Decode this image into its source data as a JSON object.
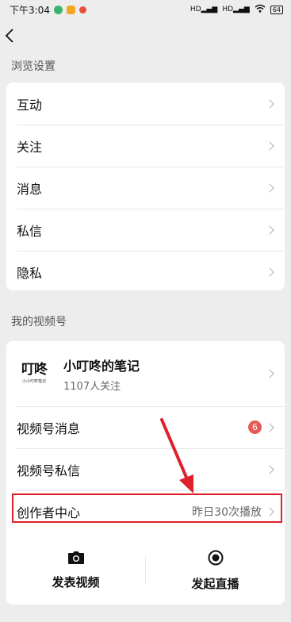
{
  "status_bar": {
    "time": "下午3:04",
    "signal1": "HD",
    "signal2": "HD",
    "battery": "64"
  },
  "browse_settings": {
    "title": "浏览设置",
    "items": [
      {
        "label": "互动"
      },
      {
        "label": "关注"
      },
      {
        "label": "消息"
      },
      {
        "label": "私信"
      },
      {
        "label": "隐私"
      }
    ]
  },
  "channels": {
    "title": "我的视频号",
    "profile": {
      "avatar_text": "叮咚",
      "avatar_caption": "小小叮咚笔记",
      "name": "小叮咚的笔记",
      "followers": "1107人关注"
    },
    "messages_label": "视频号消息",
    "messages_badge": "6",
    "private_label": "视频号私信",
    "creator_label": "创作者中心",
    "creator_stat": "昨日30次播放",
    "post_video_label": "发表视频",
    "live_label": "发起直播"
  },
  "colors": {
    "annotation": "#e0202a",
    "badge": "#e55a55",
    "background": "#ededed"
  }
}
